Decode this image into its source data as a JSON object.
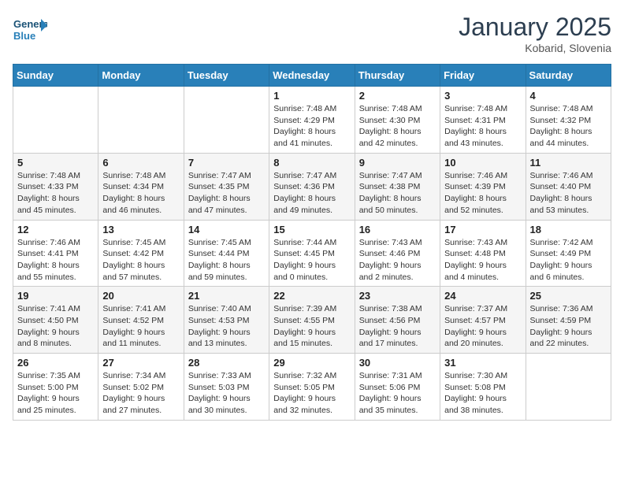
{
  "header": {
    "logo_line1": "General",
    "logo_line2": "Blue",
    "month_title": "January 2025",
    "location": "Kobarid, Slovenia"
  },
  "days_of_week": [
    "Sunday",
    "Monday",
    "Tuesday",
    "Wednesday",
    "Thursday",
    "Friday",
    "Saturday"
  ],
  "weeks": [
    [
      {
        "day": "",
        "info": ""
      },
      {
        "day": "",
        "info": ""
      },
      {
        "day": "",
        "info": ""
      },
      {
        "day": "1",
        "info": "Sunrise: 7:48 AM\nSunset: 4:29 PM\nDaylight: 8 hours and 41 minutes."
      },
      {
        "day": "2",
        "info": "Sunrise: 7:48 AM\nSunset: 4:30 PM\nDaylight: 8 hours and 42 minutes."
      },
      {
        "day": "3",
        "info": "Sunrise: 7:48 AM\nSunset: 4:31 PM\nDaylight: 8 hours and 43 minutes."
      },
      {
        "day": "4",
        "info": "Sunrise: 7:48 AM\nSunset: 4:32 PM\nDaylight: 8 hours and 44 minutes."
      }
    ],
    [
      {
        "day": "5",
        "info": "Sunrise: 7:48 AM\nSunset: 4:33 PM\nDaylight: 8 hours and 45 minutes."
      },
      {
        "day": "6",
        "info": "Sunrise: 7:48 AM\nSunset: 4:34 PM\nDaylight: 8 hours and 46 minutes."
      },
      {
        "day": "7",
        "info": "Sunrise: 7:47 AM\nSunset: 4:35 PM\nDaylight: 8 hours and 47 minutes."
      },
      {
        "day": "8",
        "info": "Sunrise: 7:47 AM\nSunset: 4:36 PM\nDaylight: 8 hours and 49 minutes."
      },
      {
        "day": "9",
        "info": "Sunrise: 7:47 AM\nSunset: 4:38 PM\nDaylight: 8 hours and 50 minutes."
      },
      {
        "day": "10",
        "info": "Sunrise: 7:46 AM\nSunset: 4:39 PM\nDaylight: 8 hours and 52 minutes."
      },
      {
        "day": "11",
        "info": "Sunrise: 7:46 AM\nSunset: 4:40 PM\nDaylight: 8 hours and 53 minutes."
      }
    ],
    [
      {
        "day": "12",
        "info": "Sunrise: 7:46 AM\nSunset: 4:41 PM\nDaylight: 8 hours and 55 minutes."
      },
      {
        "day": "13",
        "info": "Sunrise: 7:45 AM\nSunset: 4:42 PM\nDaylight: 8 hours and 57 minutes."
      },
      {
        "day": "14",
        "info": "Sunrise: 7:45 AM\nSunset: 4:44 PM\nDaylight: 8 hours and 59 minutes."
      },
      {
        "day": "15",
        "info": "Sunrise: 7:44 AM\nSunset: 4:45 PM\nDaylight: 9 hours and 0 minutes."
      },
      {
        "day": "16",
        "info": "Sunrise: 7:43 AM\nSunset: 4:46 PM\nDaylight: 9 hours and 2 minutes."
      },
      {
        "day": "17",
        "info": "Sunrise: 7:43 AM\nSunset: 4:48 PM\nDaylight: 9 hours and 4 minutes."
      },
      {
        "day": "18",
        "info": "Sunrise: 7:42 AM\nSunset: 4:49 PM\nDaylight: 9 hours and 6 minutes."
      }
    ],
    [
      {
        "day": "19",
        "info": "Sunrise: 7:41 AM\nSunset: 4:50 PM\nDaylight: 9 hours and 8 minutes."
      },
      {
        "day": "20",
        "info": "Sunrise: 7:41 AM\nSunset: 4:52 PM\nDaylight: 9 hours and 11 minutes."
      },
      {
        "day": "21",
        "info": "Sunrise: 7:40 AM\nSunset: 4:53 PM\nDaylight: 9 hours and 13 minutes."
      },
      {
        "day": "22",
        "info": "Sunrise: 7:39 AM\nSunset: 4:55 PM\nDaylight: 9 hours and 15 minutes."
      },
      {
        "day": "23",
        "info": "Sunrise: 7:38 AM\nSunset: 4:56 PM\nDaylight: 9 hours and 17 minutes."
      },
      {
        "day": "24",
        "info": "Sunrise: 7:37 AM\nSunset: 4:57 PM\nDaylight: 9 hours and 20 minutes."
      },
      {
        "day": "25",
        "info": "Sunrise: 7:36 AM\nSunset: 4:59 PM\nDaylight: 9 hours and 22 minutes."
      }
    ],
    [
      {
        "day": "26",
        "info": "Sunrise: 7:35 AM\nSunset: 5:00 PM\nDaylight: 9 hours and 25 minutes."
      },
      {
        "day": "27",
        "info": "Sunrise: 7:34 AM\nSunset: 5:02 PM\nDaylight: 9 hours and 27 minutes."
      },
      {
        "day": "28",
        "info": "Sunrise: 7:33 AM\nSunset: 5:03 PM\nDaylight: 9 hours and 30 minutes."
      },
      {
        "day": "29",
        "info": "Sunrise: 7:32 AM\nSunset: 5:05 PM\nDaylight: 9 hours and 32 minutes."
      },
      {
        "day": "30",
        "info": "Sunrise: 7:31 AM\nSunset: 5:06 PM\nDaylight: 9 hours and 35 minutes."
      },
      {
        "day": "31",
        "info": "Sunrise: 7:30 AM\nSunset: 5:08 PM\nDaylight: 9 hours and 38 minutes."
      },
      {
        "day": "",
        "info": ""
      }
    ]
  ]
}
